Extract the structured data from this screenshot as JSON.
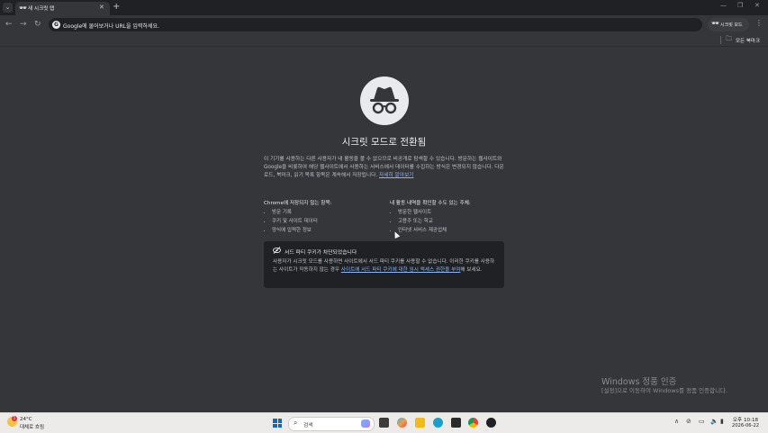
{
  "browser": {
    "tab": {
      "icon": "incognito-icon",
      "title": "새 시크릿 탭",
      "close": "✕"
    },
    "new_tab": "+",
    "tab_menu": "⌄",
    "window_controls": {
      "minimize": "—",
      "maximize": "❐",
      "close": "✕"
    },
    "nav": {
      "back": "←",
      "forward": "→",
      "reload": "↻"
    },
    "omnibox": {
      "g": "G",
      "placeholder": "Google에 물어보거나 URL을 입력하세요."
    },
    "incognito_chip": {
      "icon": "incognito-icon",
      "label": "시크릿 모드"
    },
    "menu": "⋮",
    "bookmarks": {
      "all_bookmarks": "모든 북마크"
    }
  },
  "incognito": {
    "heading": "시크릿 모드로 전환됨",
    "intro": "이 기기를 사용하는 다른 사용자가 내 활동을 볼 수 없으므로 비공개로 탐색할 수 있습니다. 방문하는 웹사이트와 Google을 비롯하여 해당 웹사이트에서 사용하는 서비스에서 데이터를 수집하는 방식은 변경되지 않습니다. 다운로드, 북마크, 읽기 목록 항목은 계속해서 저장됩니다.",
    "learn_more": "자세히 알아보기",
    "not_saved": {
      "title": "Chrome에 저장되지 않는 항목:",
      "items": [
        "방문 기록",
        "쿠키 및 사이트 데이터",
        "양식에 입력한 정보"
      ]
    },
    "visible_to": {
      "title": "내 활동 내역을 확인할 수도 있는 주체:",
      "items": [
        "방문한 웹사이트",
        "고용주 또는 학교",
        "인터넷 서비스 제공업체"
      ]
    },
    "cookie_box": {
      "title": "서드 파티 쿠키가 차단되었습니다",
      "body_pre": "사용자가 시크릿 모드를 사용하면 사이트에서 서드 파티 쿠키를 사용할 수 없습니다. 이러한 쿠키를 사용하는 사이트가 작동하지 않는 경우 ",
      "body_link": "사이트에 서드 파티 쿠키에 대한 임시 액세스 권한을 부여",
      "body_post": "해 보세요."
    }
  },
  "watermark": {
    "title": "Windows 정품 인증",
    "subtitle": "[설정]으로 이동하여 Windows를 정품 인증합니다."
  },
  "taskbar": {
    "weather": {
      "temp": "24°C",
      "condition": "대체로 흐림",
      "badge": "1"
    },
    "search_placeholder": "검색",
    "tray_chevron": "∧",
    "clock": {
      "time": "오후 10:18",
      "date": "2026-06-22"
    }
  },
  "colors": {
    "page_bg": "#35363a",
    "tab_strip": "#202124",
    "link": "#8ab4f8",
    "taskbar": "#ecebe9"
  }
}
